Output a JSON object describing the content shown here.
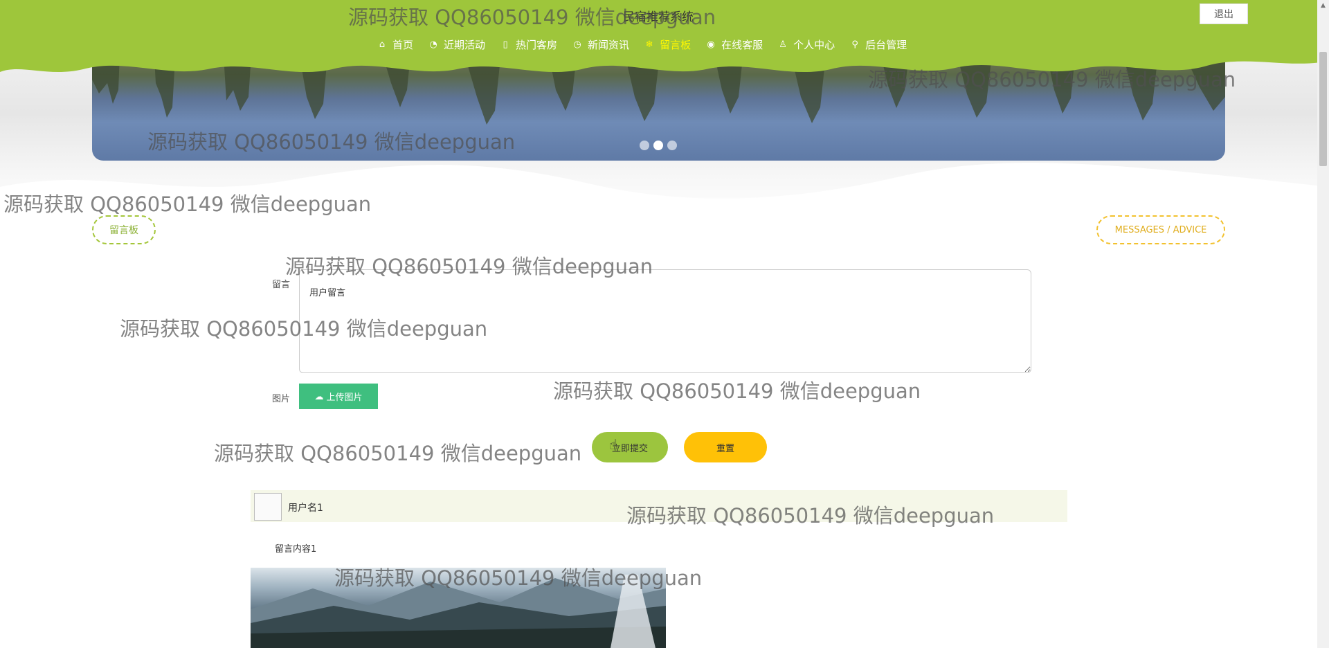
{
  "header": {
    "site_title": "民宿推荐系统",
    "logout_label": "退出",
    "nav": [
      {
        "label": "首页",
        "icon": "home-icon",
        "glyph": "⌂",
        "active": false
      },
      {
        "label": "近期活动",
        "icon": "gauge-icon",
        "glyph": "◔",
        "active": false
      },
      {
        "label": "热门客房",
        "icon": "bookmark-icon",
        "glyph": "▯",
        "active": false
      },
      {
        "label": "新闻资讯",
        "icon": "clock-icon",
        "glyph": "◷",
        "active": false
      },
      {
        "label": "留言板",
        "icon": "snowflake-icon",
        "glyph": "❄",
        "active": true
      },
      {
        "label": "在线客服",
        "icon": "compass-icon",
        "glyph": "◉",
        "active": false
      },
      {
        "label": "个人中心",
        "icon": "user-icon",
        "glyph": "♙",
        "active": false
      },
      {
        "label": "后台管理",
        "icon": "link-icon",
        "glyph": "⚲",
        "active": false
      }
    ]
  },
  "carousel": {
    "dots": 3,
    "active_index": 1
  },
  "section": {
    "title": "留言板",
    "subtitle": "MESSAGES / ADVICE"
  },
  "form": {
    "message_label": "留言",
    "message_placeholder": "用户留言",
    "image_label": "图片",
    "upload_label": "上传图片",
    "submit_label": "立即提交",
    "reset_label": "重置"
  },
  "messages": [
    {
      "username": "用户名1",
      "content": "留言内容1"
    }
  ],
  "watermark_text": "源码获取 QQ86050149 微信deepguan",
  "colors": {
    "header_green": "#9ec63b",
    "nav_active": "#fff700",
    "upload_green": "#3fbf7f",
    "submit_green": "#9cc53e",
    "reset_yellow": "#ffc107"
  }
}
